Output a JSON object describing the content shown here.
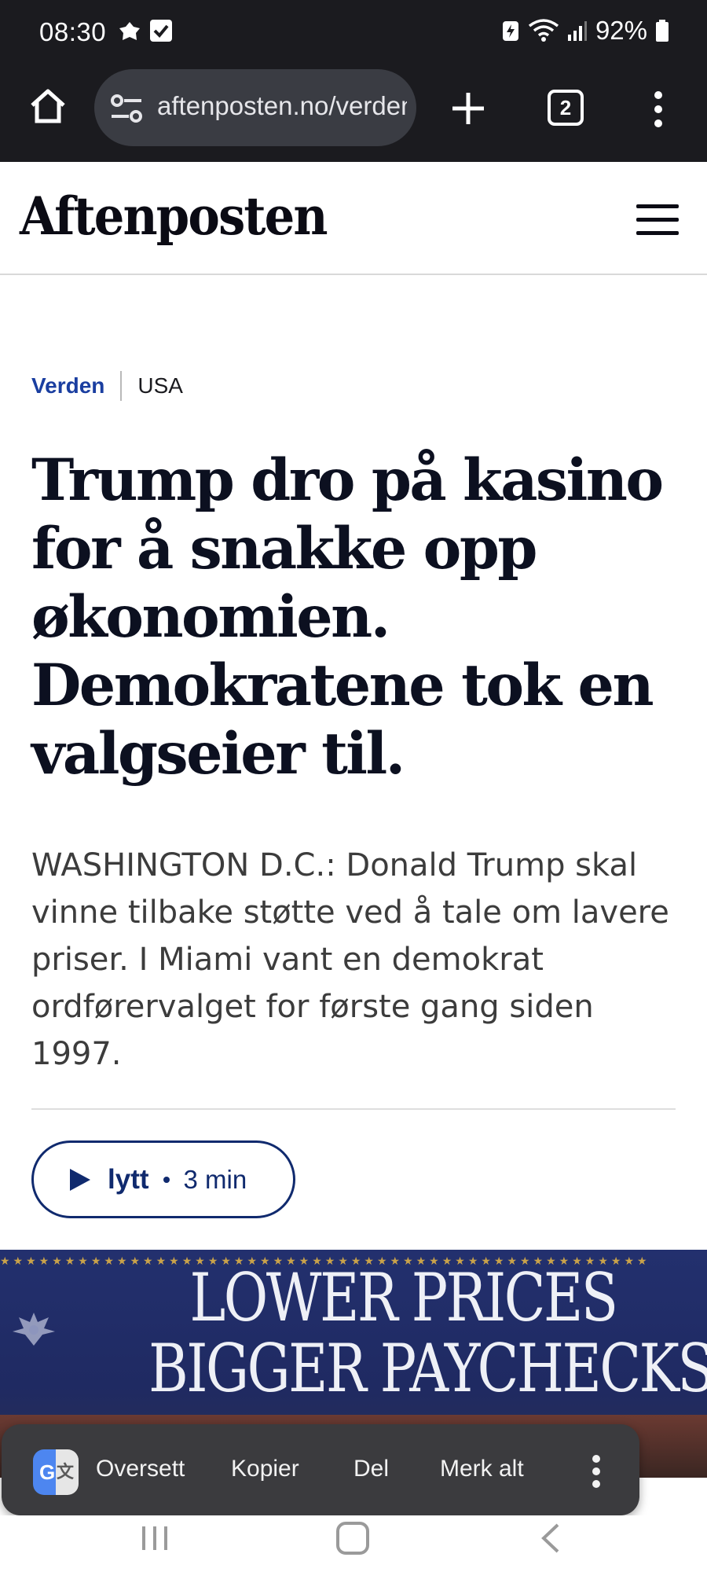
{
  "status_bar": {
    "time": "08:30",
    "battery": "92%",
    "icons": [
      "notification-icon",
      "checkbox-icon",
      "battery-saver-icon",
      "wifi-icon",
      "signal-icon",
      "battery-icon"
    ]
  },
  "browser": {
    "url": "aftenposten.no/verden",
    "tab_count": "2"
  },
  "site": {
    "logo": "Aftenposten"
  },
  "article": {
    "section": "Verden",
    "subsection": "USA",
    "headline": "Trump dro på kasino for å snakke opp økonomien. Demokratene tok en valgseier til.",
    "lead": "WASHINGTON D.C.: Donald Trump skal vinne tilbake støtte ved å tale om lavere priser. I Miami vant en demokrat ordførervalget for første gang siden 1997.",
    "listen_label": "lytt",
    "listen_duration": "3 min"
  },
  "hero_image": {
    "banner_line1": "LOWER PRICES",
    "banner_line2": "BIGGER PAYCHECKS"
  },
  "selection_toolbar": {
    "translate": "Oversett",
    "copy": "Kopier",
    "share": "Del",
    "select_all": "Merk alt"
  },
  "colors": {
    "accent_blue": "#1a3ea0",
    "navy": "#102a6e",
    "browser_bg": "#1b1b1f",
    "headline": "#0c1020"
  }
}
